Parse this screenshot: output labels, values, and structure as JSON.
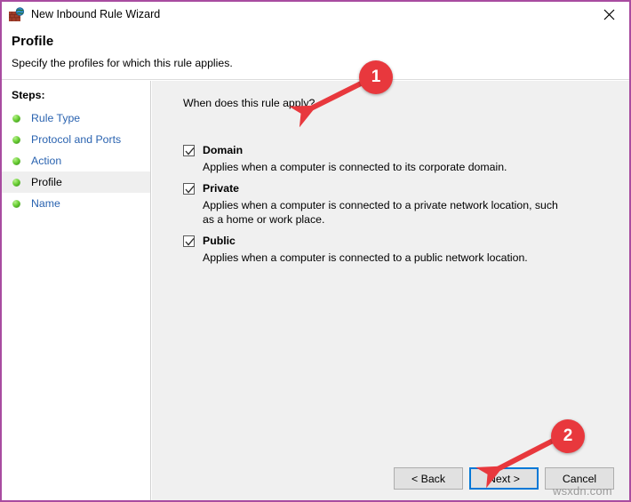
{
  "window": {
    "title": "New Inbound Rule Wizard",
    "app_icon": "firewall-brick-wall-globe-icon",
    "close_label": "✕",
    "border_color": "#a84ca0"
  },
  "header": {
    "title": "Profile",
    "subtitle": "Specify the profiles for which this rule applies."
  },
  "sidebar": {
    "heading": "Steps:",
    "items": [
      {
        "label": "Rule Type",
        "current": false
      },
      {
        "label": "Protocol and Ports",
        "current": false
      },
      {
        "label": "Action",
        "current": false
      },
      {
        "label": "Profile",
        "current": true
      },
      {
        "label": "Name",
        "current": false
      }
    ]
  },
  "main": {
    "question": "When does this rule apply?",
    "profiles": [
      {
        "name": "Domain",
        "description": "Applies when a computer is connected to its corporate domain.",
        "checked": true
      },
      {
        "name": "Private",
        "description": "Applies when a computer is connected to a private network location, such as a home or work place.",
        "checked": true
      },
      {
        "name": "Public",
        "description": "Applies when a computer is connected to a public network location.",
        "checked": true
      }
    ]
  },
  "buttons": {
    "back": "< Back",
    "next": "Next >",
    "cancel": "Cancel",
    "focus_color": "#0078d7"
  },
  "annotations": {
    "badge_color": "#e8383d",
    "items": [
      {
        "number": "1",
        "points_to": "question-text"
      },
      {
        "number": "2",
        "points_to": "next-button"
      }
    ]
  },
  "watermark": {
    "text": "wsxdn.com"
  }
}
